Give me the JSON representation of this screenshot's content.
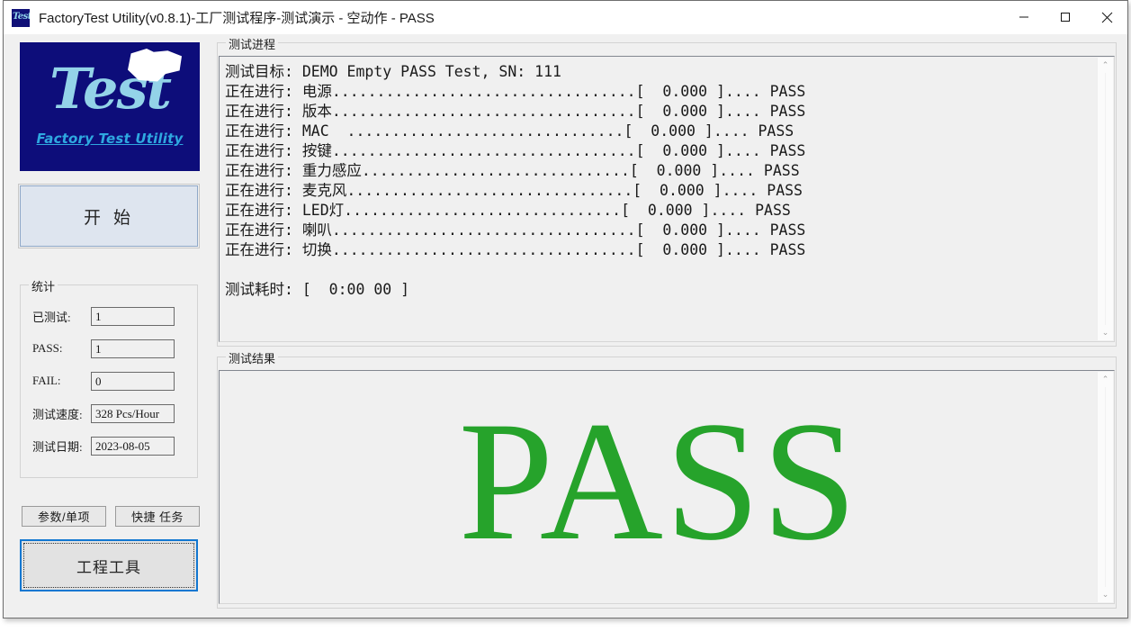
{
  "window": {
    "title": "FactoryTest Utility(v0.8.1)-工厂测试程序-测试演示 - 空动作 - PASS",
    "icon_label": "Test",
    "minimize_label": "minimize",
    "maximize_label": "maximize",
    "close_label": "close"
  },
  "logo": {
    "script_text": "Test",
    "subtitle": "Factory Test Utility",
    "background_color": "#0d0d7a",
    "script_color": "#93d3e8",
    "subtitle_color": "#2ea8e0"
  },
  "start_button": {
    "label": "开 始"
  },
  "stats": {
    "title": "统计",
    "rows": [
      {
        "label": "已测试:",
        "value": "1"
      },
      {
        "label": "PASS:",
        "value": "1"
      },
      {
        "label": "FAIL:",
        "value": "0"
      },
      {
        "label": "测试速度:",
        "value": "328 Pcs/Hour"
      },
      {
        "label": "测试日期:",
        "value": "2023-08-05"
      }
    ]
  },
  "buttons": {
    "param": "参数/单项",
    "task": "快捷 任务",
    "engineering_tools": "工程工具"
  },
  "progress": {
    "title": "测试进程",
    "target_line": "测试目标: DEMO Empty PASS Test, SN: 111",
    "items": [
      {
        "name": "电源",
        "padded": "电源..................................",
        "time": "0.000",
        "result": "PASS"
      },
      {
        "name": "版本",
        "padded": "版本..................................",
        "time": "0.000",
        "result": "PASS"
      },
      {
        "name": "MAC",
        "padded": "MAC  ...............................",
        "time": "0.000",
        "result": "PASS"
      },
      {
        "name": "按键",
        "padded": "按键..................................",
        "time": "0.000",
        "result": "PASS"
      },
      {
        "name": "重力感应",
        "padded": "重力感应..............................",
        "time": "0.000",
        "result": "PASS"
      },
      {
        "name": "麦克风",
        "padded": "麦克风................................",
        "time": "0.000",
        "result": "PASS"
      },
      {
        "name": "LED灯",
        "padded": "LED灯...............................",
        "time": "0.000",
        "result": "PASS"
      },
      {
        "name": "喇叭",
        "padded": "喇叭..................................",
        "time": "0.000",
        "result": "PASS"
      },
      {
        "name": "切换",
        "padded": "切换..................................",
        "time": "0.000",
        "result": "PASS"
      }
    ],
    "prefix": "正在进行: ",
    "elapsed_line": "测试耗时: [  0:00 00 ]",
    "log_text": "测试目标: DEMO Empty PASS Test, SN: 111\n正在进行: 电源..................................[  0.000 ].... PASS\n正在进行: 版本..................................[  0.000 ].... PASS\n正在进行: MAC  ...............................[  0.000 ].... PASS\n正在进行: 按键..................................[  0.000 ].... PASS\n正在进行: 重力感应..............................[  0.000 ].... PASS\n正在进行: 麦克风................................[  0.000 ].... PASS\n正在进行: LED灯...............................[  0.000 ].... PASS\n正在进行: 喇叭..................................[  0.000 ].... PASS\n正在进行: 切换..................................[  0.000 ].... PASS\n\n测试耗时: [  0:00 00 ]"
  },
  "result": {
    "title": "测试结果",
    "verdict": "PASS",
    "verdict_color": "#26a32b"
  },
  "scrollbar": {
    "up_arrow": "⌃",
    "down_arrow": "⌄"
  }
}
